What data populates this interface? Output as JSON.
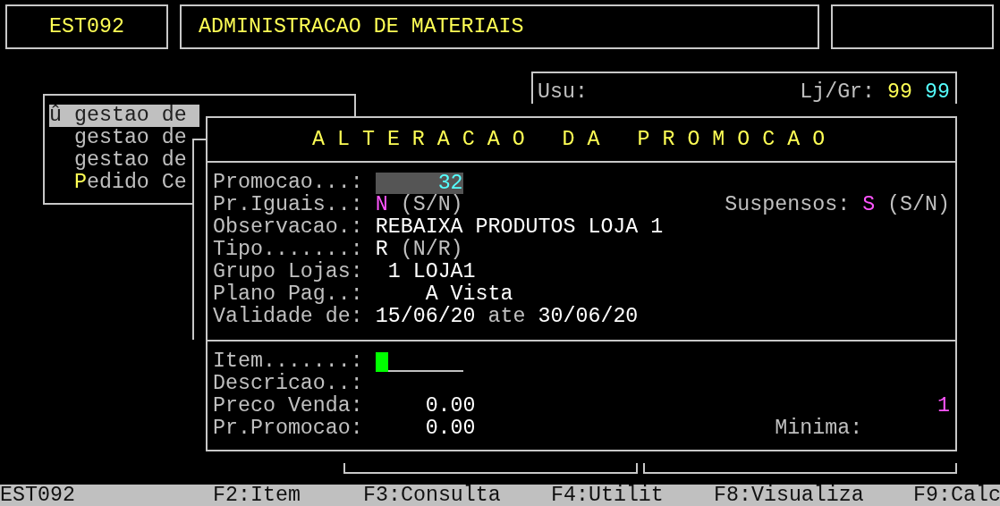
{
  "header": {
    "code": "EST092",
    "title": "ADMINISTRACAO DE MATERIAIS"
  },
  "user_panel": {
    "user_label": "Usu:",
    "store_label": "Lj/Gr:",
    "store": "99",
    "group": "99"
  },
  "menu": {
    "items": [
      {
        "marker": "û",
        "label": "gestao de",
        "selected": true,
        "hotkey_highlighted": false
      },
      {
        "label": "gestao de",
        "selected": false,
        "hotkey_highlighted": false
      },
      {
        "label": "gestao de",
        "selected": false,
        "hotkey_highlighted": false
      },
      {
        "label": "Pedido Ce",
        "selected": false,
        "hotkey_highlighted": true
      }
    ]
  },
  "dialog": {
    "title": "A L T E R A C A O   D A   P R O M O C A O",
    "fields": [
      {
        "kind": "number",
        "label": "Promocao...:",
        "value": "32"
      },
      {
        "kind": "flag",
        "label": "Pr.Iguais..:",
        "value": "N",
        "hint": "(S/N)",
        "aside": {
          "label": "Suspensos:",
          "value": "S",
          "hint": "(S/N)"
        }
      },
      {
        "kind": "text",
        "label": "Observacao.:",
        "value": "REBAIXA PRODUTOS LOJA 1"
      },
      {
        "kind": "choice",
        "label": "Tipo.......:",
        "value": "R",
        "hint": "(N/R)"
      },
      {
        "kind": "text",
        "label": "Grupo Lojas:",
        "value": " 1 LOJA1"
      },
      {
        "kind": "text",
        "label": "Plano Pag..:",
        "value": "    A Vista"
      },
      {
        "kind": "range",
        "label": "Validade de:",
        "from": "15/06/20",
        "joiner": "ate",
        "to": "30/06/20"
      }
    ],
    "item_fields": [
      {
        "kind": "input",
        "label": "Item.......:"
      },
      {
        "kind": "empty",
        "label": "Descricao..:"
      },
      {
        "kind": "price",
        "label": "Preco Venda:",
        "value": "0.00",
        "aside_value": "1"
      },
      {
        "kind": "price",
        "label": "Pr.Promocao:",
        "value": "0.00",
        "aside_label": "Minima:"
      }
    ]
  },
  "status_bar": [
    "EST092",
    "F2:Item",
    "F3:Consulta",
    "F4:Utilit",
    "F8:Visualiza",
    "F9:Calc"
  ]
}
